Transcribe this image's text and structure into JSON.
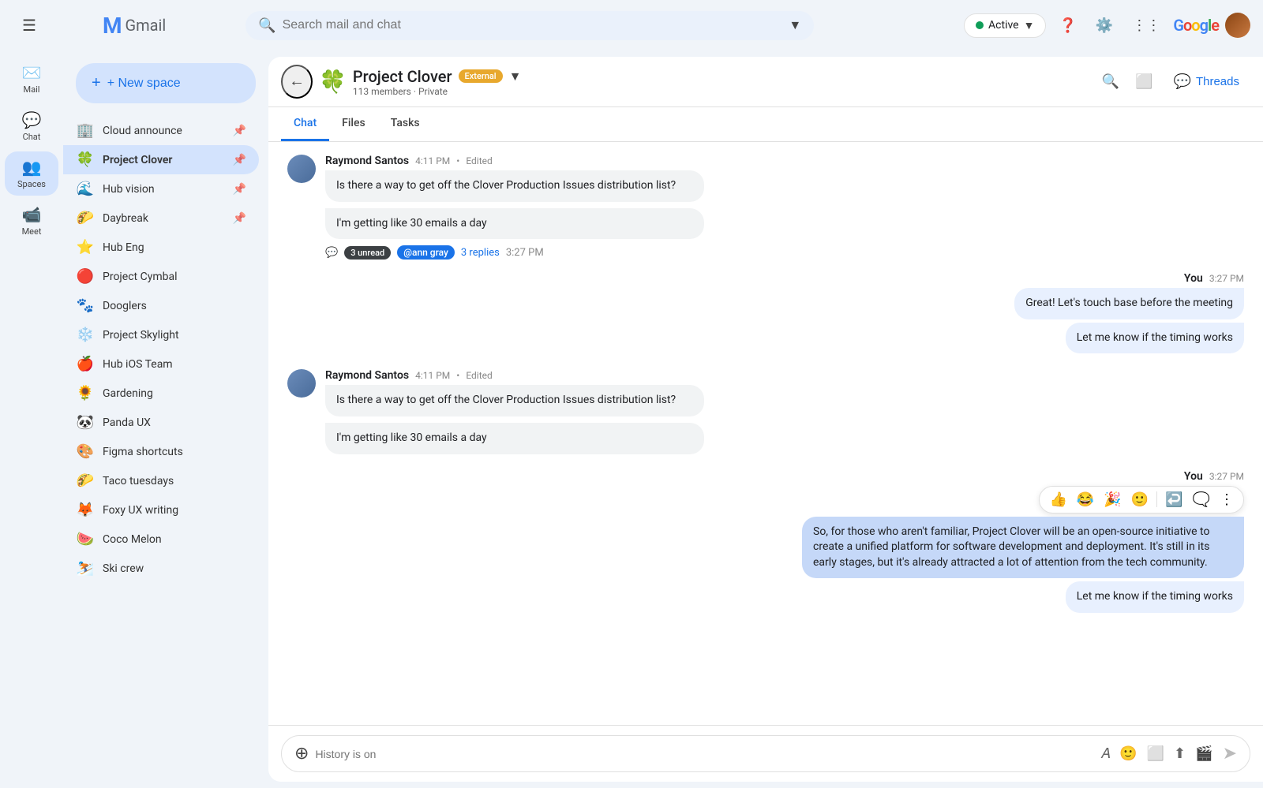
{
  "header": {
    "search_placeholder": "Search mail and chat",
    "active_label": "Active",
    "google_label": "Google"
  },
  "gmail_logo": "Gmail",
  "nav": {
    "items": [
      {
        "id": "mail",
        "icon": "✉",
        "label": "Mail"
      },
      {
        "id": "chat",
        "icon": "💬",
        "label": "Chat"
      },
      {
        "id": "spaces",
        "icon": "👥",
        "label": "Spaces"
      },
      {
        "id": "meet",
        "icon": "📹",
        "label": "Meet"
      }
    ]
  },
  "sidebar": {
    "new_space_label": "+ New space",
    "items": [
      {
        "id": "cloud-announce",
        "emoji": "🏢",
        "label": "Cloud announce",
        "pinned": true
      },
      {
        "id": "project-clover",
        "emoji": "🍀",
        "label": "Project Clover",
        "pinned": true,
        "active": true
      },
      {
        "id": "hub-vision",
        "emoji": "🌊",
        "label": "Hub vision",
        "pinned": true
      },
      {
        "id": "daybreak",
        "emoji": "🌮",
        "label": "Daybreak",
        "pinned": true
      },
      {
        "id": "hub-eng",
        "emoji": "⭐",
        "label": "Hub Eng"
      },
      {
        "id": "project-cymbal",
        "emoji": "🔴",
        "label": "Project Cymbal"
      },
      {
        "id": "dooglers",
        "emoji": "🐾",
        "label": "Dooglers"
      },
      {
        "id": "project-skylight",
        "emoji": "❄",
        "label": "Project Skylight"
      },
      {
        "id": "hub-ios",
        "emoji": "🍎",
        "label": "Hub iOS Team"
      },
      {
        "id": "gardening",
        "emoji": "🌻",
        "label": "Gardening"
      },
      {
        "id": "panda-ux",
        "emoji": "🐼",
        "label": "Panda UX"
      },
      {
        "id": "figma-shortcuts",
        "emoji": "🎨",
        "label": "Figma shortcuts"
      },
      {
        "id": "taco-tuesdays",
        "emoji": "🌮",
        "label": "Taco tuesdays"
      },
      {
        "id": "foxy-ux",
        "emoji": "🦊",
        "label": "Foxy UX writing"
      },
      {
        "id": "coco-melon",
        "emoji": "🍉",
        "label": "Coco Melon"
      },
      {
        "id": "ski-crew",
        "emoji": "⛷",
        "label": "Ski crew"
      }
    ]
  },
  "space": {
    "name": "Project Clover",
    "emoji": "🍀",
    "badge": "External",
    "subtitle": "113 members · Private",
    "tabs": [
      "Chat",
      "Files",
      "Tasks"
    ],
    "active_tab": "Chat",
    "threads_label": "Threads"
  },
  "messages": [
    {
      "id": "msg1",
      "sender": "Raymond Santos",
      "time": "4:11 PM",
      "edited": "Edited",
      "bubbles": [
        "Is there a way to get off the Clover Production Issues distribution list?",
        "I'm getting like 30 emails a day"
      ],
      "thread": {
        "unread": "3 unread",
        "mention": "@ann gray",
        "replies": "3 replies",
        "time": "3:27 PM"
      }
    }
  ],
  "outgoing1": {
    "sender": "You",
    "time": "3:27 PM",
    "bubbles": [
      "Great! Let's touch base before the meeting",
      "Let me know if the timing works"
    ]
  },
  "msg2": {
    "sender": "Raymond Santos",
    "time": "4:11 PM",
    "edited": "Edited",
    "bubbles": [
      "Is there a way to get off the Clover Production Issues distribution list?",
      "I'm getting like 30 emails a day"
    ]
  },
  "outgoing2": {
    "sender": "You",
    "time": "3:27 PM",
    "reactions": [
      "👍",
      "😂",
      "🎉",
      "🙂"
    ],
    "long_message": "So, for those who aren't familiar, Project Clover will be an open-source initiative to create a unified platform for software development and deployment. It's still in its early stages, but it's already attracted a lot of attention from the tech community.",
    "follow_up": "Let me know if the timing works"
  },
  "input": {
    "placeholder": "History is on"
  }
}
